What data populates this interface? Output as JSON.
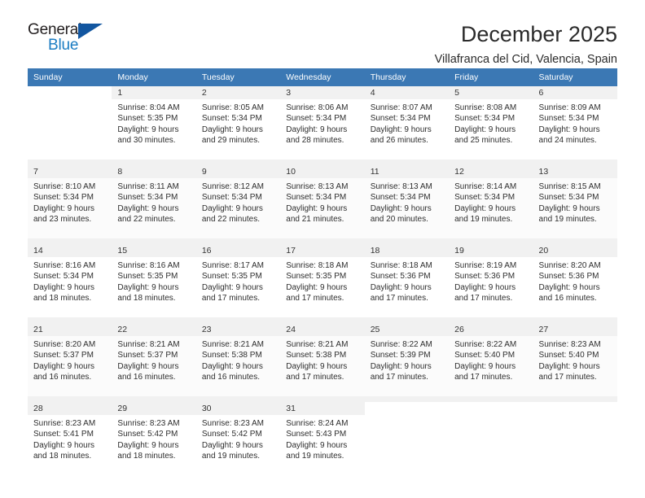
{
  "logo": {
    "word_top": "General",
    "word_bottom": "Blue",
    "triangle_color": "#1256a0",
    "blue_color": "#1a7cc2"
  },
  "header": {
    "month_title": "December 2025",
    "location": "Villafranca del Cid, Valencia, Spain"
  },
  "theme": {
    "header_bg": "#3b78b4",
    "header_text": "#ffffff",
    "daynum_bg": "#f1f1f1"
  },
  "calendar": {
    "weekday_headers": [
      "Sunday",
      "Monday",
      "Tuesday",
      "Wednesday",
      "Thursday",
      "Friday",
      "Saturday"
    ],
    "weeks": [
      [
        {
          "day": "",
          "lines": []
        },
        {
          "day": "1",
          "lines": [
            "Sunrise: 8:04 AM",
            "Sunset: 5:35 PM",
            "Daylight: 9 hours",
            "and 30 minutes."
          ]
        },
        {
          "day": "2",
          "lines": [
            "Sunrise: 8:05 AM",
            "Sunset: 5:34 PM",
            "Daylight: 9 hours",
            "and 29 minutes."
          ]
        },
        {
          "day": "3",
          "lines": [
            "Sunrise: 8:06 AM",
            "Sunset: 5:34 PM",
            "Daylight: 9 hours",
            "and 28 minutes."
          ]
        },
        {
          "day": "4",
          "lines": [
            "Sunrise: 8:07 AM",
            "Sunset: 5:34 PM",
            "Daylight: 9 hours",
            "and 26 minutes."
          ]
        },
        {
          "day": "5",
          "lines": [
            "Sunrise: 8:08 AM",
            "Sunset: 5:34 PM",
            "Daylight: 9 hours",
            "and 25 minutes."
          ]
        },
        {
          "day": "6",
          "lines": [
            "Sunrise: 8:09 AM",
            "Sunset: 5:34 PM",
            "Daylight: 9 hours",
            "and 24 minutes."
          ]
        }
      ],
      [
        {
          "day": "7",
          "lines": [
            "Sunrise: 8:10 AM",
            "Sunset: 5:34 PM",
            "Daylight: 9 hours",
            "and 23 minutes."
          ]
        },
        {
          "day": "8",
          "lines": [
            "Sunrise: 8:11 AM",
            "Sunset: 5:34 PM",
            "Daylight: 9 hours",
            "and 22 minutes."
          ]
        },
        {
          "day": "9",
          "lines": [
            "Sunrise: 8:12 AM",
            "Sunset: 5:34 PM",
            "Daylight: 9 hours",
            "and 22 minutes."
          ]
        },
        {
          "day": "10",
          "lines": [
            "Sunrise: 8:13 AM",
            "Sunset: 5:34 PM",
            "Daylight: 9 hours",
            "and 21 minutes."
          ]
        },
        {
          "day": "11",
          "lines": [
            "Sunrise: 8:13 AM",
            "Sunset: 5:34 PM",
            "Daylight: 9 hours",
            "and 20 minutes."
          ]
        },
        {
          "day": "12",
          "lines": [
            "Sunrise: 8:14 AM",
            "Sunset: 5:34 PM",
            "Daylight: 9 hours",
            "and 19 minutes."
          ]
        },
        {
          "day": "13",
          "lines": [
            "Sunrise: 8:15 AM",
            "Sunset: 5:34 PM",
            "Daylight: 9 hours",
            "and 19 minutes."
          ]
        }
      ],
      [
        {
          "day": "14",
          "lines": [
            "Sunrise: 8:16 AM",
            "Sunset: 5:34 PM",
            "Daylight: 9 hours",
            "and 18 minutes."
          ]
        },
        {
          "day": "15",
          "lines": [
            "Sunrise: 8:16 AM",
            "Sunset: 5:35 PM",
            "Daylight: 9 hours",
            "and 18 minutes."
          ]
        },
        {
          "day": "16",
          "lines": [
            "Sunrise: 8:17 AM",
            "Sunset: 5:35 PM",
            "Daylight: 9 hours",
            "and 17 minutes."
          ]
        },
        {
          "day": "17",
          "lines": [
            "Sunrise: 8:18 AM",
            "Sunset: 5:35 PM",
            "Daylight: 9 hours",
            "and 17 minutes."
          ]
        },
        {
          "day": "18",
          "lines": [
            "Sunrise: 8:18 AM",
            "Sunset: 5:36 PM",
            "Daylight: 9 hours",
            "and 17 minutes."
          ]
        },
        {
          "day": "19",
          "lines": [
            "Sunrise: 8:19 AM",
            "Sunset: 5:36 PM",
            "Daylight: 9 hours",
            "and 17 minutes."
          ]
        },
        {
          "day": "20",
          "lines": [
            "Sunrise: 8:20 AM",
            "Sunset: 5:36 PM",
            "Daylight: 9 hours",
            "and 16 minutes."
          ]
        }
      ],
      [
        {
          "day": "21",
          "lines": [
            "Sunrise: 8:20 AM",
            "Sunset: 5:37 PM",
            "Daylight: 9 hours",
            "and 16 minutes."
          ]
        },
        {
          "day": "22",
          "lines": [
            "Sunrise: 8:21 AM",
            "Sunset: 5:37 PM",
            "Daylight: 9 hours",
            "and 16 minutes."
          ]
        },
        {
          "day": "23",
          "lines": [
            "Sunrise: 8:21 AM",
            "Sunset: 5:38 PM",
            "Daylight: 9 hours",
            "and 16 minutes."
          ]
        },
        {
          "day": "24",
          "lines": [
            "Sunrise: 8:21 AM",
            "Sunset: 5:38 PM",
            "Daylight: 9 hours",
            "and 17 minutes."
          ]
        },
        {
          "day": "25",
          "lines": [
            "Sunrise: 8:22 AM",
            "Sunset: 5:39 PM",
            "Daylight: 9 hours",
            "and 17 minutes."
          ]
        },
        {
          "day": "26",
          "lines": [
            "Sunrise: 8:22 AM",
            "Sunset: 5:40 PM",
            "Daylight: 9 hours",
            "and 17 minutes."
          ]
        },
        {
          "day": "27",
          "lines": [
            "Sunrise: 8:23 AM",
            "Sunset: 5:40 PM",
            "Daylight: 9 hours",
            "and 17 minutes."
          ]
        }
      ],
      [
        {
          "day": "28",
          "lines": [
            "Sunrise: 8:23 AM",
            "Sunset: 5:41 PM",
            "Daylight: 9 hours",
            "and 18 minutes."
          ]
        },
        {
          "day": "29",
          "lines": [
            "Sunrise: 8:23 AM",
            "Sunset: 5:42 PM",
            "Daylight: 9 hours",
            "and 18 minutes."
          ]
        },
        {
          "day": "30",
          "lines": [
            "Sunrise: 8:23 AM",
            "Sunset: 5:42 PM",
            "Daylight: 9 hours",
            "and 19 minutes."
          ]
        },
        {
          "day": "31",
          "lines": [
            "Sunrise: 8:24 AM",
            "Sunset: 5:43 PM",
            "Daylight: 9 hours",
            "and 19 minutes."
          ]
        },
        {
          "day": "",
          "lines": []
        },
        {
          "day": "",
          "lines": []
        },
        {
          "day": "",
          "lines": []
        }
      ]
    ]
  }
}
